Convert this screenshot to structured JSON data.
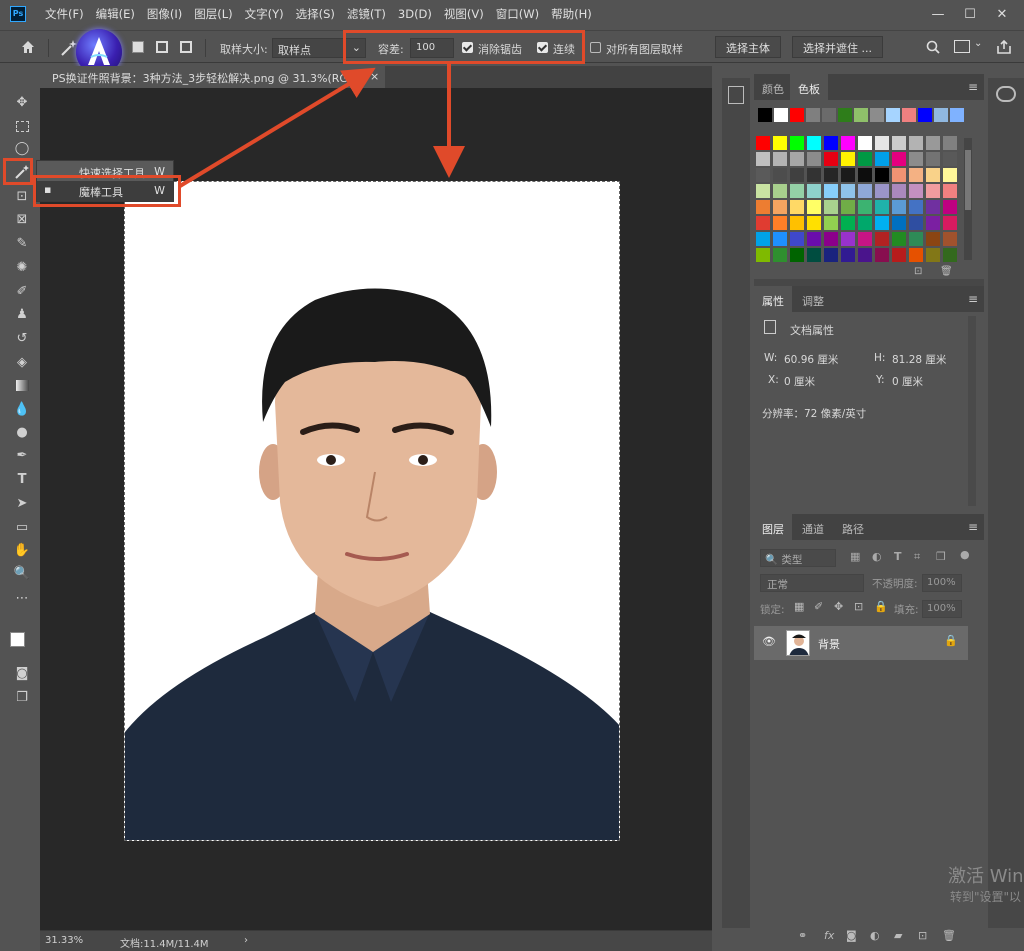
{
  "app": {
    "logo": "Ps"
  },
  "menubar": {
    "items": [
      "文件(F)",
      "编辑(E)",
      "图像(I)",
      "图层(L)",
      "文字(Y)",
      "选择(S)",
      "滤镜(T)",
      "3D(D)",
      "视图(V)",
      "窗口(W)",
      "帮助(H)"
    ]
  },
  "window_controls": {
    "minimize": "—",
    "restore": "☐",
    "close": "✕"
  },
  "options": {
    "sample_size_label": "取样大小:",
    "sample_size_value": "取样点",
    "tolerance_label": "容差:",
    "tolerance_value": "100",
    "antialias_label": "消除锯齿",
    "antialias_checked": true,
    "contiguous_label": "连续",
    "contiguous_checked": true,
    "all_layers_label": "对所有图层取样",
    "all_layers_checked": false,
    "select_subject": "选择主体",
    "select_and_mask": "选择并遮住 ..."
  },
  "document": {
    "tab_title": "PS换证件照背景：3种方法_3步轻松解决.png @ 31.3%(RGB",
    "close": "×"
  },
  "flyout": {
    "items": [
      {
        "label": "快速选择工具",
        "key": "W"
      },
      {
        "label": "魔棒工具",
        "key": "W"
      }
    ]
  },
  "statusbar": {
    "zoom": "31.33%",
    "doc": "文档:11.4M/11.4M",
    "arrow": "›"
  },
  "swatches_panel": {
    "tabs": [
      "颜色",
      "色板"
    ],
    "active_tab": "色板",
    "recent": [
      "#000000",
      "#ffffff",
      "#ff0000",
      "#7f7f7f",
      "#6b6b6b",
      "#2e7d1a",
      "#8fc06a",
      "#8c8c8c",
      "#a6d4ff",
      "#f08080",
      "#0000ff",
      "#90b8e0",
      "#7fb2ff"
    ],
    "rows": [
      [
        "#ff0000",
        "#ffff00",
        "#00ff00",
        "#00ffff",
        "#0000ff",
        "#ff00ff",
        "#ffffff",
        "#e6e6e6",
        "#cccccc",
        "#b3b3b3",
        "#999999",
        "#808080"
      ],
      [
        "#bfbfbf",
        "#b3b3b3",
        "#a6a6a6",
        "#8c8c8c",
        "#e60012",
        "#fff100",
        "#009944",
        "#00a0e9",
        "#e4007f",
        "#8c8c8c",
        "#737373",
        "#595959"
      ],
      [
        "#5a5a5a",
        "#4d4d4d",
        "#404040",
        "#333333",
        "#262626",
        "#1a1a1a",
        "#0d0d0d",
        "#000000",
        "#f19373",
        "#f4b183",
        "#f9d289",
        "#fff799"
      ],
      [
        "#c9e3a2",
        "#a8d08d",
        "#94d0a6",
        "#8ed1cc",
        "#87cefa",
        "#8fc3ea",
        "#8fa8d8",
        "#9b95c9",
        "#aa89bd",
        "#c490bf",
        "#f29c9f",
        "#f08080"
      ],
      [
        "#ed7d31",
        "#f4a460",
        "#ffd966",
        "#ffff66",
        "#a9d18e",
        "#70ad47",
        "#3cb371",
        "#20b2aa",
        "#5b9bd5",
        "#4472c4",
        "#7030a0",
        "#c00080"
      ],
      [
        "#e03c31",
        "#ff7f27",
        "#ffc000",
        "#ffe000",
        "#92d050",
        "#00b050",
        "#00a86b",
        "#00b0f0",
        "#0070c0",
        "#2f4ea1",
        "#7b1fa2",
        "#d81b60"
      ],
      [
        "#00a2e8",
        "#1e90ff",
        "#3f48cc",
        "#6a0dad",
        "#8b008b",
        "#9932cc",
        "#c71585",
        "#b22222",
        "#228b22",
        "#2e8b57",
        "#8b4513",
        "#a0522d"
      ],
      [
        "#7fba00",
        "#2f8f2f",
        "#006400",
        "#004d40",
        "#1a237e",
        "#311b92",
        "#4a148c",
        "#880e4f",
        "#b71c1c",
        "#e65100",
        "#827717",
        "#33691e"
      ]
    ]
  },
  "properties_panel": {
    "tabs": [
      "属性",
      "调整"
    ],
    "active_tab": "属性",
    "title": "文档属性",
    "w_label": "W:",
    "w_value": "60.96 厘米",
    "h_label": "H:",
    "h_value": "81.28 厘米",
    "x_label": "X:",
    "x_value": "0 厘米",
    "y_label": "Y:",
    "y_value": "0 厘米",
    "resolution": "分辨率：72 像素/英寸"
  },
  "layers_panel": {
    "tabs": [
      "图层",
      "通道",
      "路径"
    ],
    "active_tab": "图层",
    "filter_label": "类型",
    "blend_mode": "正常",
    "opacity_label": "不透明度:",
    "opacity_value": "100%",
    "lock_label": "锁定:",
    "fill_label": "填充:",
    "fill_value": "100%",
    "layer_name": "背景"
  },
  "watermark": {
    "line1": "激活 Win",
    "line2": "转到\"设置\"以"
  }
}
